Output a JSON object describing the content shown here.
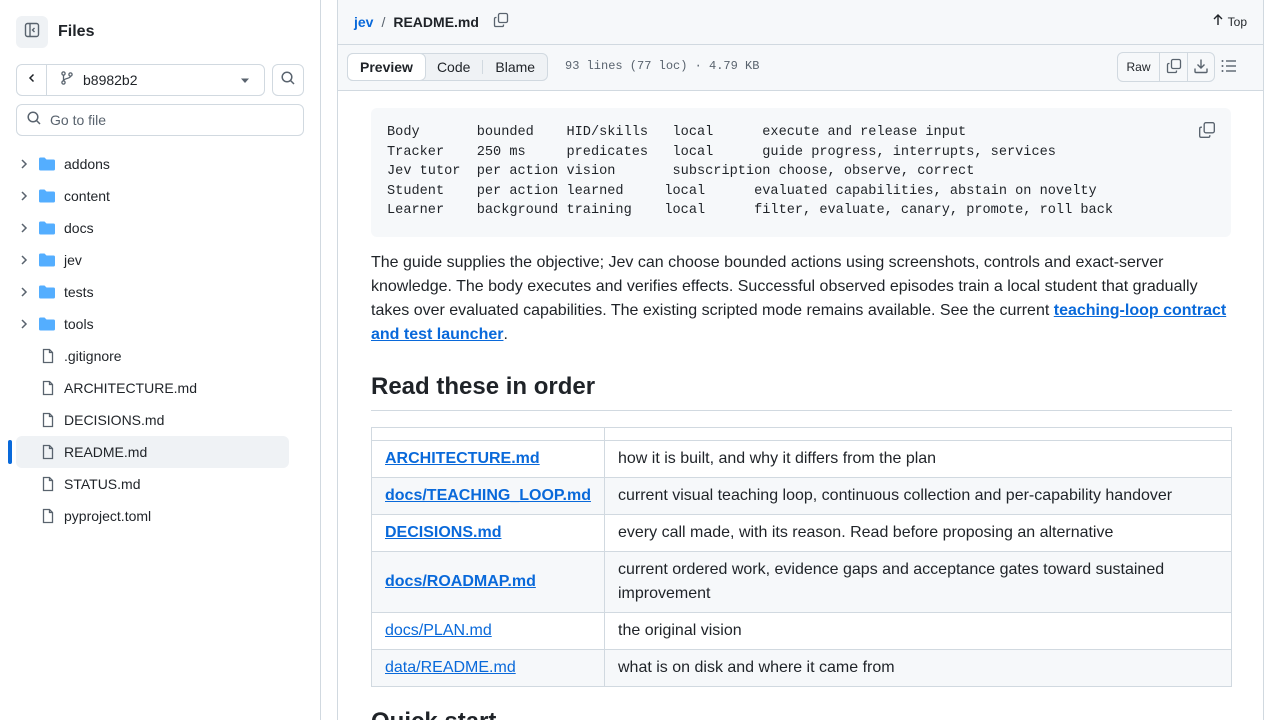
{
  "sidebar": {
    "title": "Files",
    "branch": "b8982b2",
    "goto_placeholder": "Go to file",
    "folders": [
      "addons",
      "content",
      "docs",
      "jev",
      "tests",
      "tools"
    ],
    "files": [
      ".gitignore",
      "ARCHITECTURE.md",
      "DECISIONS.md",
      "README.md",
      "STATUS.md",
      "pyproject.toml"
    ],
    "active_file": "README.md"
  },
  "header": {
    "repo": "jev",
    "separator": "/",
    "file": "README.md",
    "top_label": "Top"
  },
  "toolbar": {
    "tabs": [
      "Preview",
      "Code",
      "Blame"
    ],
    "active_tab": "Preview",
    "meta": "93 lines (77 loc) · 4.79 KB",
    "raw_label": "Raw"
  },
  "content": {
    "code_lines": [
      "Body       bounded    HID/skills   local      execute and release input",
      "Tracker    250 ms     predicates   local      guide progress, interrupts, services",
      "Jev tutor  per action vision       subscription choose, observe, correct",
      "Student    per action learned     local      evaluated capabilities, abstain on novelty",
      "Learner    background training    local      filter, evaluate, canary, promote, roll back"
    ],
    "paragraph_text": "The guide supplies the objective; Jev can choose bounded actions using screenshots, controls and exact-server knowledge. The body executes and verifies effects. Successful observed episodes train a local student that gradually takes over evaluated capabilities. The existing scripted mode remains available. See the current ",
    "paragraph_link": "teaching-loop contract and test launcher",
    "paragraph_end": ".",
    "heading": "Read these in order",
    "table_rows": [
      {
        "link": "ARCHITECTURE.md",
        "bold": true,
        "desc": "how it is built, and why it differs from the plan"
      },
      {
        "link": "docs/TEACHING_LOOP.md",
        "bold": true,
        "desc": "current visual teaching loop, continuous collection and per-capability handover"
      },
      {
        "link": "DECISIONS.md",
        "bold": true,
        "desc": "every call made, with its reason. Read before proposing an alternative"
      },
      {
        "link": "docs/ROADMAP.md",
        "bold": true,
        "desc": "current ordered work, evidence gaps and acceptance gates toward sustained improvement"
      },
      {
        "link": "docs/PLAN.md",
        "bold": false,
        "desc": "the original vision"
      },
      {
        "link": "data/README.md",
        "bold": false,
        "desc": "what is on disk and where it came from"
      }
    ],
    "next_heading": "Quick start"
  },
  "colors": {
    "accent": "#0969da",
    "border": "#d1d9e0",
    "muted": "#59636e",
    "canvas_subtle": "#f6f8fa"
  },
  "icons": {
    "panel": "sidebar-collapse-icon",
    "branch": "git-branch-icon",
    "search": "search-icon",
    "folder": "folder-icon",
    "file": "file-icon",
    "copy": "copy-icon",
    "download": "download-icon",
    "outline": "list-unordered-icon",
    "arrow_up": "arrow-up-icon"
  }
}
